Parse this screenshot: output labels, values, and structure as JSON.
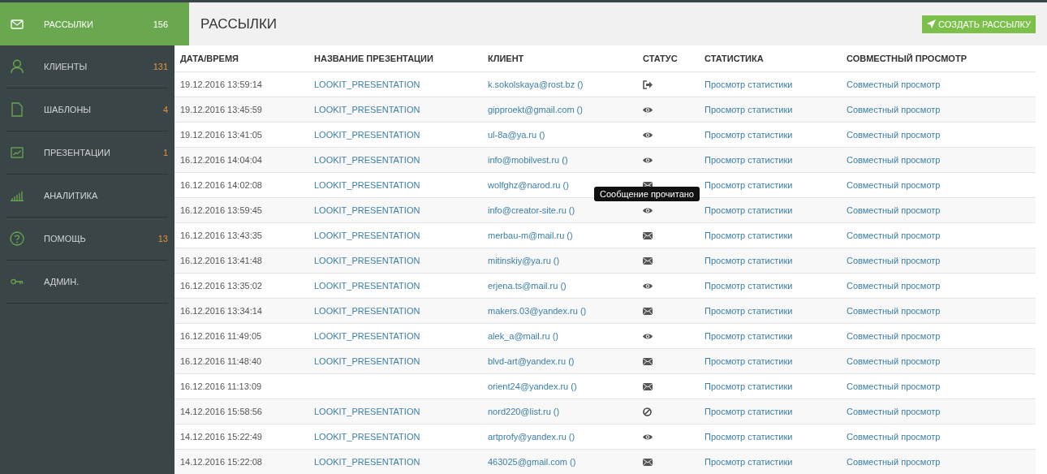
{
  "sidebar": {
    "items": [
      {
        "label": "РАССЫЛКИ",
        "count": "156",
        "selected": true
      },
      {
        "label": "КЛИЕНТЫ",
        "count": "131",
        "selected": false
      },
      {
        "label": "ШАБЛОНЫ",
        "count": "4",
        "selected": false
      },
      {
        "label": "ПРЕЗЕНТАЦИИ",
        "count": "1",
        "selected": false
      },
      {
        "label": "АНАЛИТИКА",
        "selected": false
      },
      {
        "label": "ПОМОЩЬ",
        "count": "13",
        "selected": false
      },
      {
        "label": "АДМИН.",
        "selected": false
      }
    ]
  },
  "page": {
    "title": "РАССЫЛКИ",
    "create_button": "СОЗДАТЬ РАССЫЛКУ"
  },
  "table": {
    "columns": [
      "ДАТА/ВРЕМЯ",
      "НАЗВАНИЕ ПРЕЗЕНТАЦИИ",
      "КЛИЕНТ",
      "СТАТУС",
      "СТАТИСТИКА",
      "СОВМЕСТНЫЙ ПРОСМОТР"
    ],
    "rows": [
      {
        "date": "19.12.2016 13:59:14",
        "presentation": "LOOKIT_PRESENTATION",
        "client": "k.sokolskaya@rost.bz ()",
        "kind": "opened",
        "stats": "Просмотр статистики",
        "joint": "Совместный просмотр"
      },
      {
        "date": "19.12.2016 13:45:59",
        "presentation": "LOOKIT_PRESENTATION",
        "client": "gipproekt@gmail.com ()",
        "kind": "read",
        "stats": "Просмотр статистики",
        "joint": "Совместный просмотр"
      },
      {
        "date": "19.12.2016 13:41:05",
        "presentation": "LOOKIT_PRESENTATION",
        "client": "ul-8a@ya.ru ()",
        "kind": "read",
        "stats": "Просмотр статистики",
        "joint": "Совместный просмотр"
      },
      {
        "date": "16.12.2016 14:04:04",
        "presentation": "LOOKIT_PRESENTATION",
        "client": "info@mobilvest.ru ()",
        "kind": "read",
        "stats": "Просмотр статистики",
        "joint": "Совместный просмотр"
      },
      {
        "date": "16.12.2016 14:02:08",
        "presentation": "LOOKIT_PRESENTATION",
        "client": "wolfghz@narod.ru ()",
        "kind": "sent",
        "stats": "Просмотр статистики",
        "joint": "Совместный просмотр"
      },
      {
        "date": "16.12.2016 13:59:45",
        "presentation": "LOOKIT_PRESENTATION",
        "client": "info@creator-site.ru ()",
        "kind": "read",
        "tooltip": "Сообщение прочитано",
        "stats": "Просмотр статистики",
        "joint": "Совместный просмотр"
      },
      {
        "date": "16.12.2016 13:43:35",
        "presentation": "LOOKIT_PRESENTATION",
        "client": "merbau-m@mail.ru ()",
        "kind": "sent",
        "stats": "Просмотр статистики",
        "joint": "Совместный просмотр"
      },
      {
        "date": "16.12.2016 13:41:48",
        "presentation": "LOOKIT_PRESENTATION",
        "client": "mitinskiy@ya.ru ()",
        "kind": "sent",
        "stats": "Просмотр статистики",
        "joint": "Совместный просмотр"
      },
      {
        "date": "16.12.2016 13:35:02",
        "presentation": "LOOKIT_PRESENTATION",
        "client": "erjena.ts@mail.ru ()",
        "kind": "read",
        "stats": "Просмотр статистики",
        "joint": "Совместный просмотр"
      },
      {
        "date": "16.12.2016 13:34:14",
        "presentation": "LOOKIT_PRESENTATION",
        "client": "makers.03@yandex.ru ()",
        "kind": "sent",
        "stats": "Просмотр статистики",
        "joint": "Совместный просмотр"
      },
      {
        "date": "16.12.2016 11:49:05",
        "presentation": "LOOKIT_PRESENTATION",
        "client": "alek_a@mail.ru ()",
        "kind": "read",
        "stats": "Просмотр статистики",
        "joint": "Совместный просмотр"
      },
      {
        "date": "16.12.2016 11:48:40",
        "presentation": "LOOKIT_PRESENTATION",
        "client": "blvd-art@yandex.ru ()",
        "kind": "sent",
        "stats": "Просмотр статистики",
        "joint": "Совместный просмотр"
      },
      {
        "date": "16.12.2016 11:13:09",
        "client": "orient24@yandex.ru ()",
        "kind": "sent",
        "stats": "Просмотр статистики",
        "joint": "Совместный просмотр"
      },
      {
        "date": "14.12.2016 15:58:56",
        "presentation": "LOOKIT_PRESENTATION",
        "client": "nord220@list.ru ()",
        "kind": "blocked",
        "stats": "Просмотр статистики",
        "joint": "Совместный просмотр"
      },
      {
        "date": "14.12.2016 15:22:49",
        "presentation": "LOOKIT_PRESENTATION",
        "client": "artprofy@yandex.ru ()",
        "kind": "read",
        "stats": "Просмотр статистики",
        "joint": "Совместный просмотр"
      },
      {
        "date": "14.12.2016 15:22:08",
        "presentation": "LOOKIT_PRESENTATION",
        "client": "463025@gmail.com ()",
        "kind": "sent",
        "stats": "Просмотр статистики",
        "joint": "Совместный просмотр"
      }
    ]
  }
}
